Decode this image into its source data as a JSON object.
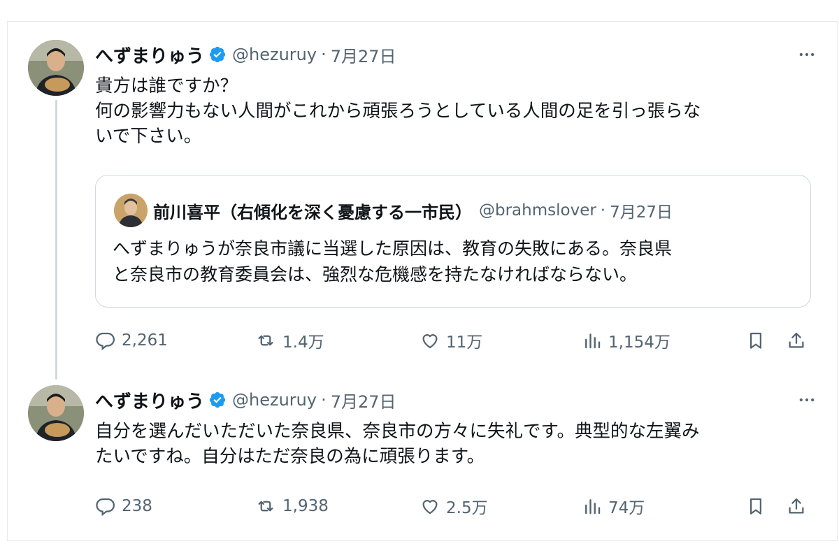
{
  "tweets": [
    {
      "display_name": "へずまりゅう",
      "handle": "@hezuruy",
      "separator": "·",
      "date": "7月27日",
      "text": "貴方は誰ですか？\n何の影響力もない人間がこれから頑張ろうとしている人間の足を引っ張らな\nいで下さい。",
      "quote": {
        "display_name": "前川喜平（右傾化を深く憂慮する一市民）",
        "handle": "@brahmslover",
        "separator": "·",
        "date": "7月27日",
        "text": "へずまりゅうが奈良市議に当選した原因は、教育の失敗にある。奈良県\nと奈良市の教育委員会は、強烈な危機感を持たなければならない。"
      },
      "metrics": {
        "replies": "2,261",
        "reposts": "1.4万",
        "likes": "11万",
        "views": "1,154万"
      }
    },
    {
      "display_name": "へずまりゅう",
      "handle": "@hezuruy",
      "separator": "·",
      "date": "7月27日",
      "text": "自分を選んだいただいた奈良県、奈良市の方々に失礼です。典型的な左翼み\nたいですね。自分はただ奈良の為に頑張ります。",
      "metrics": {
        "replies": "238",
        "reposts": "1,938",
        "likes": "2.5万",
        "views": "74万"
      }
    }
  ],
  "icons": {
    "verified": "verified-badge-icon",
    "more": "more-horizontal-icon",
    "reply": "reply-icon",
    "repost": "repost-icon",
    "like": "heart-icon",
    "views": "views-chart-icon",
    "bookmark": "bookmark-icon",
    "share": "share-icon"
  },
  "colors": {
    "text": "#0f1419",
    "secondary": "#536471",
    "verified": "#1d9bf0",
    "border": "#cfd9de"
  }
}
